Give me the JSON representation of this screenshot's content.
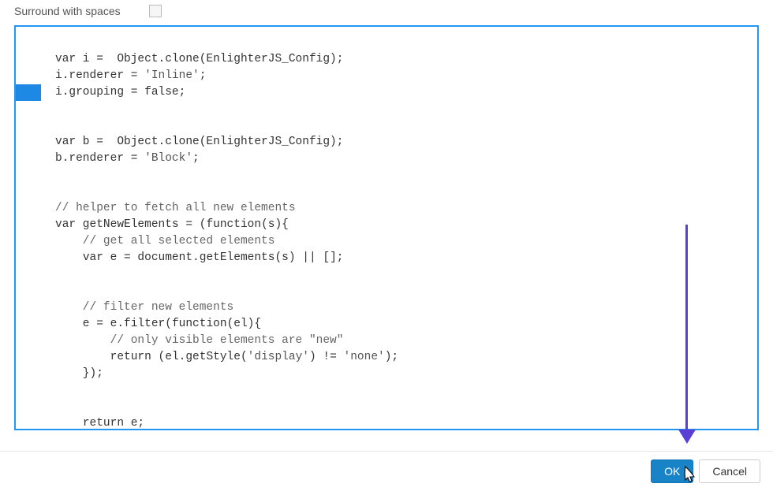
{
  "option": {
    "label": "Surround with spaces",
    "checked": false
  },
  "code": {
    "l1a": "var",
    "l1b": " i =  Object.clone(EnlighterJS_Config);",
    "l2a": "i.renderer = ",
    "l2b": "'Inline'",
    "l2c": ";",
    "l3a": "i.grouping = ",
    "l3b": "false",
    "l3c": ";",
    "l4a": "var",
    "l4b": " b =  Object.clone(EnlighterJS_Config);",
    "l5a": "b.renderer = ",
    "l5b": "'Block'",
    "l5c": ";",
    "l6": "// helper to fetch all new elements",
    "l7a": "var",
    "l7b": " getNewElements = (",
    "l7c": "function",
    "l7d": "(s){",
    "l8": "    // get all selected elements",
    "l9a": "    ",
    "l9b": "var",
    "l9c": " e = document.getElements(s) || [];",
    "l10": "    // filter new elements",
    "l11a": "    e = e.filter(",
    "l11b": "function",
    "l11c": "(el){",
    "l12": "        // only visible elements are \"new\"",
    "l13a": "        ",
    "l13b": "return",
    "l13c": " (el.getStyle(",
    "l13d": "'display'",
    "l13e": ") != ",
    "l13f": "'none'",
    "l13g": ");",
    "l14": "    });",
    "l15a": "    ",
    "l15b": "return",
    "l15c": " e;",
    "l16": "});"
  },
  "buttons": {
    "ok": "OK",
    "cancel": "Cancel"
  }
}
